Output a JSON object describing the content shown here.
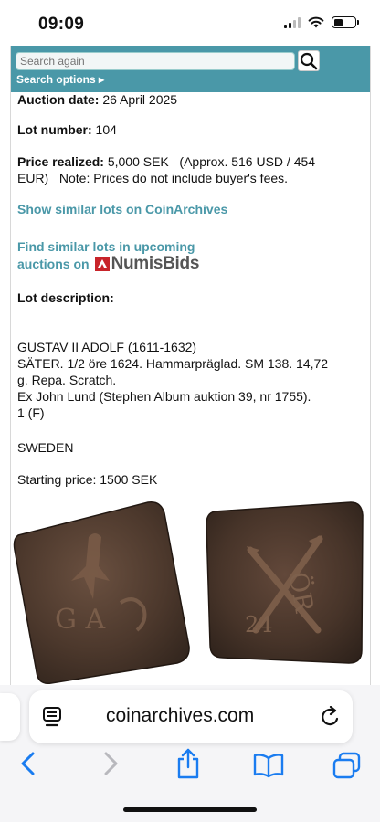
{
  "status_bar": {
    "time": "09:09"
  },
  "search": {
    "placeholder": "Search again",
    "options_label": "Search options ▸"
  },
  "lot": {
    "auction_date_label": "Auction date:",
    "auction_date_value": "26 April 2025",
    "lot_number_label": "Lot number:",
    "lot_number_value": "104",
    "price_label": "Price realized:",
    "price_value_line1": "5,000 SEK   (Approx. 516 USD / 454",
    "price_value_line2": "EUR)   Note: Prices do not include buyer's fees.",
    "show_similar_link": "Show similar lots on CoinArchives",
    "find_similar_line1": "Find similar lots in upcoming",
    "find_similar_line2": "auctions on",
    "numisbids_logo_text": "NumisBids",
    "description_label": "Lot description:",
    "description_lines": [
      "GUSTAV II ADOLF (1611-1632)",
      "SÄTER. 1/2 öre 1624. Hammarpräglad. SM 138. 14,72",
      "g. Repa. Scratch.",
      "Ex John Lund (Stephen Album auktion 39, nr 1755).",
      "1 (F)"
    ],
    "country": "SWEDEN",
    "starting_price": "Starting price: 1500 SEK"
  },
  "coin_image": {
    "obverse_letters": "G A",
    "reverse_letters": "ÖR",
    "reverse_date": "24"
  },
  "browser": {
    "url": "coinarchives.com",
    "icons": [
      "page-menu-icon",
      "reload-icon",
      "back-icon",
      "forward-icon",
      "share-icon",
      "bookmarks-icon",
      "tabs-icon"
    ]
  },
  "colors": {
    "accent": "#4a98a8",
    "ios_blue": "#1a7cf0",
    "numisbids_red": "#c8242a"
  }
}
